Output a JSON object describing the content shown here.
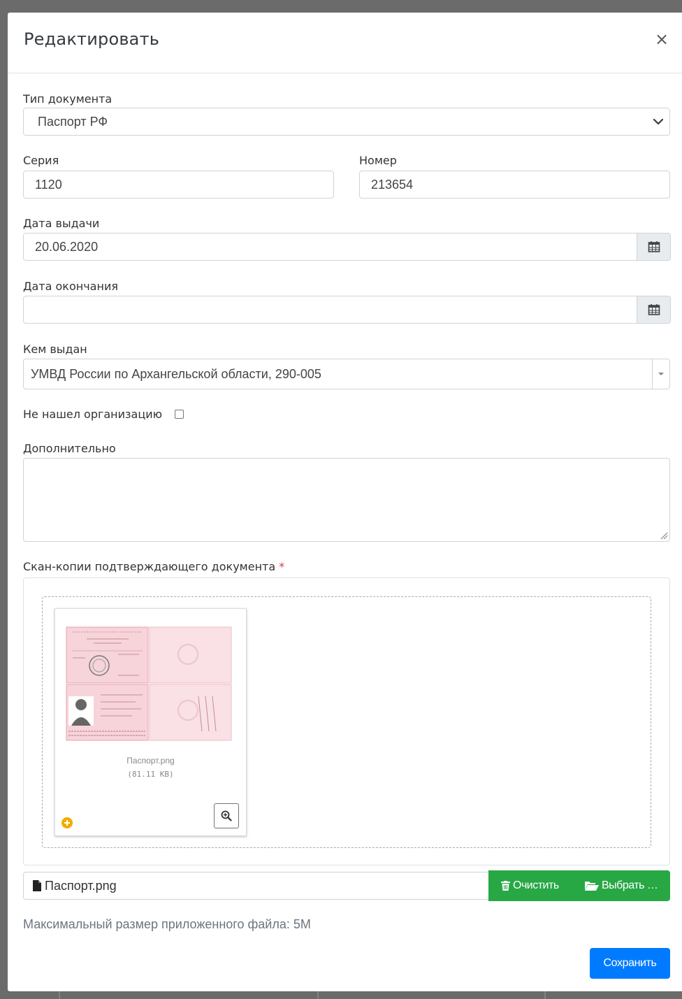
{
  "modal": {
    "title": "Редактировать",
    "close_symbol": "×"
  },
  "document_type": {
    "label": "Тип документа",
    "value": "Паспорт РФ"
  },
  "series": {
    "label": "Серия",
    "value": "1120"
  },
  "number": {
    "label": "Номер",
    "value": "213654"
  },
  "issue_date": {
    "label": "Дата выдачи",
    "value": "20.06.2020"
  },
  "expiry_date": {
    "label": "Дата окончания",
    "value": ""
  },
  "issued_by": {
    "label": "Кем выдан",
    "value": "УМВД России по Архангельской области, 290-005"
  },
  "org_not_found": {
    "label": "Не нашел организацию",
    "checked": false
  },
  "additional": {
    "label": "Дополнительно",
    "value": ""
  },
  "scans": {
    "label": "Скан-копии подтверждающего документа",
    "required_mark": "*",
    "file": {
      "name": "Паспорт.png",
      "size": "(81.11 KB)"
    },
    "caption": "Паспорт.png",
    "clear_label": "Очистить",
    "browse_label": "Выбрать …"
  },
  "hint": "Максимальный размер приложенного файла: 5M",
  "save_label": "Сохранить",
  "colors": {
    "primary": "#007bff",
    "success": "#28a745",
    "required": "#dc3545"
  }
}
